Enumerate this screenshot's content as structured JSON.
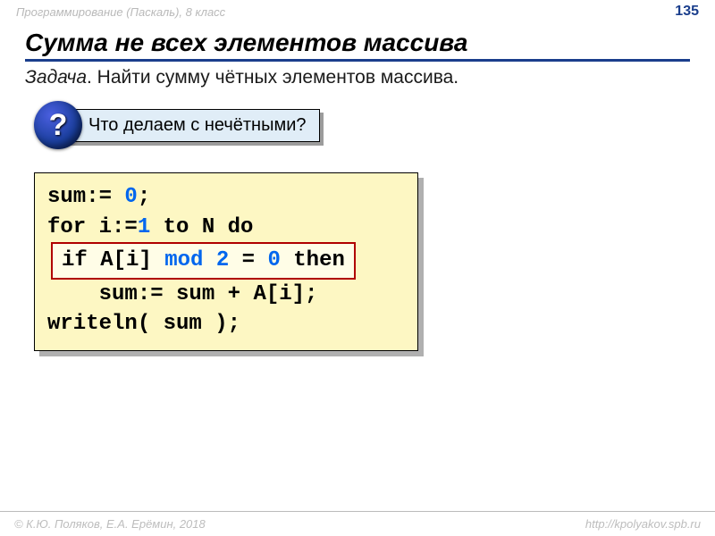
{
  "header": {
    "course": "Программирование (Паскаль), 8 класс",
    "page_number": "135"
  },
  "title": "Сумма не всех элементов массива",
  "task": {
    "label": "Задача",
    "text": ". Найти сумму чётных элементов массива."
  },
  "question": {
    "badge": "?",
    "text": "Что делаем с нечётными?"
  },
  "code": {
    "line1_a": "sum:= ",
    "line1_num": "0",
    "line1_b": ";",
    "line2_a": "for i:=",
    "line2_num": "1",
    "line2_b": " to N do",
    "cond_a": "if A[i] ",
    "cond_kw": "mod",
    "cond_b": " ",
    "cond_num": "2",
    "cond_c": " = ",
    "cond_num2": "0",
    "cond_d": " then",
    "line4": "    sum:= sum + A[i];",
    "line5": "writeln( sum );"
  },
  "footer": {
    "left": "© К.Ю. Поляков, Е.А. Ерёмин, 2018",
    "right": "http://kpolyakov.spb.ru"
  }
}
